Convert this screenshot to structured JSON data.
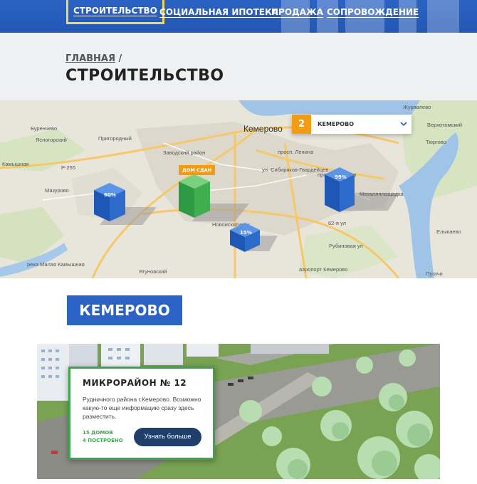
{
  "nav": {
    "items": [
      {
        "label": "СТРОИТЕЛЬСТВО",
        "active": true
      },
      {
        "label": "СОЦИАЛЬНАЯ ИПОТЕКА"
      },
      {
        "label": "ПРОДАЖА"
      },
      {
        "label": "СОПРОВОЖДЕНИЕ"
      }
    ]
  },
  "breadcrumb": {
    "home": "ГЛАВНАЯ",
    "separator": "/"
  },
  "page_title": "СТРОИТЕЛЬСТВО",
  "map": {
    "city_select": {
      "number": "2",
      "value": "КЕМЕРОВО"
    },
    "done_tag": "ДОМ СДАН",
    "markers": [
      {
        "percent": "60%",
        "color": "#2d6bcb"
      },
      {
        "percent": "15%",
        "color": "#2d6bcb"
      },
      {
        "percent": "99%",
        "color": "#2d6bcb"
      },
      {
        "percent": "",
        "color": "#3fae4f"
      }
    ],
    "places": {
      "kemerovo": "Кемерово",
      "burenichevo": "Буренчево",
      "yasnogorsky": "Ясногорский",
      "prigorodny": "Пригородный",
      "kamyshnaya": "Камышная",
      "mazurovo": "Мазурово",
      "zavodsky": "Заводский район",
      "lenina": "просп. Ленина",
      "sibiryakov": "ул. Сибиряков-Гвардейцев",
      "novoistimsk": "Новоискитимск",
      "metallploshadka": "Металлплощадка",
      "yelykaevo": "Елыкаево",
      "zhuravlevo": "Журавлево",
      "yagunovsky": "Ягуновский",
      "airport": "аэропорт Кемерово",
      "rubinovaya": "Рубиновая ул",
      "tyargovo": "Тюргово",
      "pugachi": "Пугачи",
      "r255": "Р-255",
      "khimikov": "просп. Химиков",
      "street62": "62-я ул",
      "verkhne": "Верхотомский",
      "belaya": "река Малая Камышная"
    }
  },
  "city_button": "КЕМЕРОВО",
  "project": {
    "title": "МИКРОРАЙОН № 12",
    "description": "Рудничного района г.Кемерово. Возможно какую-то еще информацию сразу здесь разместить.",
    "houses": "15 ДОМОВ",
    "built": "4 ПОСТРОЕНО",
    "more_label": "Узнать больше"
  },
  "colors": {
    "nav_bg": "#2357b3",
    "accent_orange": "#f39c12",
    "accent_green": "#3da34d",
    "button_dark": "#1f3f6a",
    "city_blue": "#2a63c4"
  }
}
